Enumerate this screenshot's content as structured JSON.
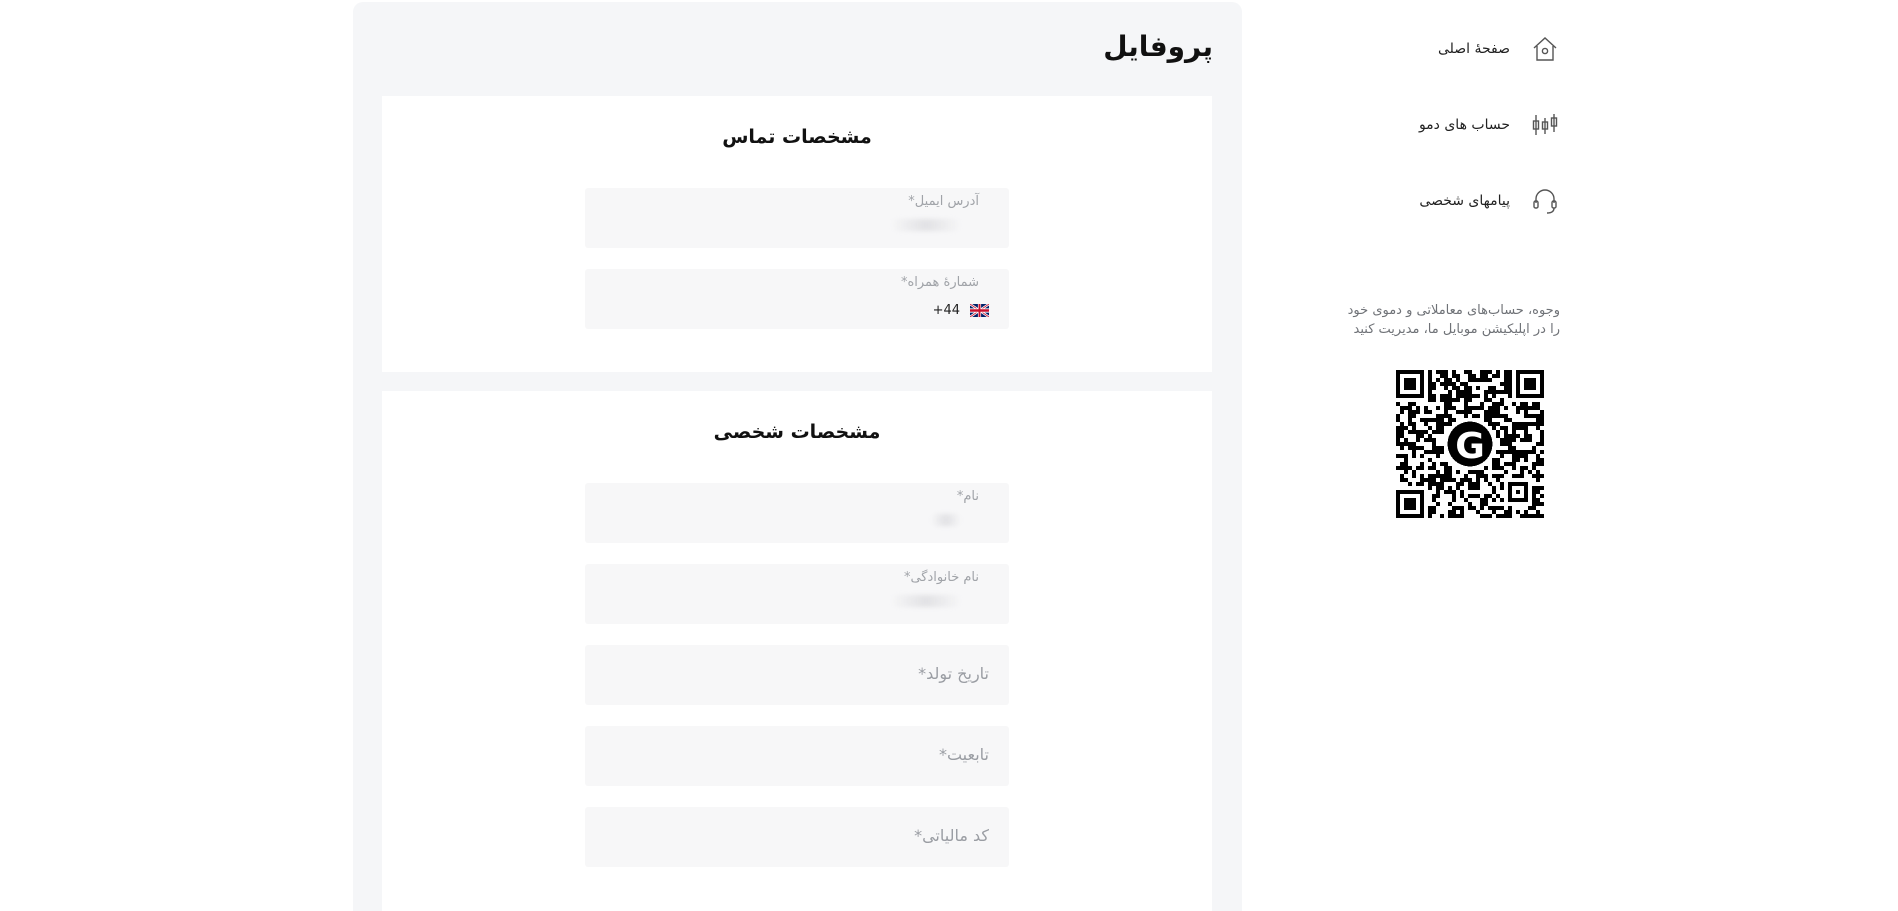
{
  "profile": {
    "title": "پروفایل",
    "contact_section": {
      "title": "مشخصات تماس",
      "email": {
        "label": "آدرس ایمیل*"
      },
      "phone": {
        "label": "شمارهٔ همراه*",
        "country_code": "+44",
        "flag": "uk-flag-icon"
      }
    },
    "personal_section": {
      "title": "مشخصات شخصی",
      "first_name": {
        "label": "نام*"
      },
      "last_name": {
        "label": "نام خانوادگی*"
      },
      "birth_date": {
        "placeholder": "تاریخ تولد*"
      },
      "nationality": {
        "placeholder": "تابعیت*"
      },
      "tax_code": {
        "placeholder": "کد مالیاتی*"
      }
    }
  },
  "sidebar": {
    "items": [
      {
        "label": "صفحهٔ اصلی",
        "icon": "home-icon"
      },
      {
        "label": "حساب های دمو",
        "icon": "candlestick-chart-icon"
      },
      {
        "label": "پیامهای شخصی",
        "icon": "headset-icon"
      }
    ],
    "promo_text": "وجوه، حساب‌های معاملاتی و دموی خود را در اپلیکیشن موبایل ما، مدیریت کنید",
    "qr_logo_letter": "G"
  },
  "colors": {
    "panel_bg": "#f5f6f8",
    "card_bg": "#ffffff",
    "field_bg": "#f7f7f8",
    "label_gray": "#a0a3a8",
    "text_dark": "#111111"
  }
}
